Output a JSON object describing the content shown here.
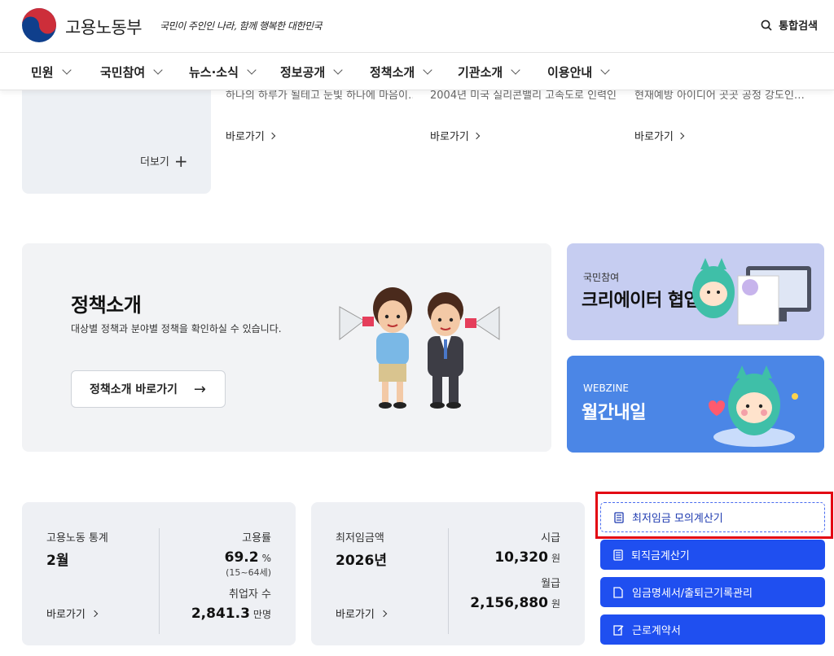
{
  "header": {
    "ministry_name": "고용노동부",
    "slogan": "국민이 주인인 나라, 함께 행복한 대한민국",
    "search_label": "통합검색"
  },
  "nav": {
    "items": [
      {
        "label": "민원"
      },
      {
        "label": "국민참여"
      },
      {
        "label": "뉴스·소식"
      },
      {
        "label": "정보공개"
      },
      {
        "label": "정책소개"
      },
      {
        "label": "기관소개"
      },
      {
        "label": "이용안내"
      }
    ]
  },
  "news": {
    "more_label": "더보기",
    "items": [
      {
        "text": "하나의 하루가 될테고 눈빛 하나에 마음이…",
        "link": "바로가기"
      },
      {
        "text": "2004년 미국 실리콘밸리 고속도로 인력인…",
        "link": "바로가기"
      },
      {
        "text": "현재예방 아이디어 곳곳 공정 강도인…",
        "link": "바로가기"
      }
    ]
  },
  "policy": {
    "title": "정책소개",
    "description": "대상별 정책과 분야별 정책을 확인하실 수 있습니다.",
    "button_label": "정책소개 바로가기",
    "button_arrow": "→"
  },
  "promos": [
    {
      "sub": "국민참여",
      "title": "크리에이터 협업"
    },
    {
      "sub": "WEBZINE",
      "title": "월간내일"
    }
  ],
  "stats": {
    "labor": {
      "label": "고용노동 통계",
      "period": "2월",
      "rate_label": "고용률",
      "rate_value": "69.2",
      "rate_unit": "%",
      "rate_note": "(15~64세)",
      "employed_label": "취업자 수",
      "employed_value": "2,841.3",
      "employed_unit": "만명",
      "link": "바로가기"
    },
    "wage": {
      "label": "최저임금액",
      "year": "2026년",
      "hourly_label": "시급",
      "hourly_value": "10,320",
      "hourly_unit": "원",
      "monthly_label": "월급",
      "monthly_value": "2,156,880",
      "monthly_unit": "원",
      "link": "바로가기"
    }
  },
  "quick_links": [
    {
      "label": "최저임금 모의계산기"
    },
    {
      "label": "퇴직금계산기"
    },
    {
      "label": "임금명세서/출퇴근기록관리"
    },
    {
      "label": "근로계약서"
    }
  ],
  "colors": {
    "accent_blue": "#1f4ff0",
    "highlight_red": "#e30613",
    "logo_red": "#cd2e3a",
    "logo_blue": "#0f3f8c"
  }
}
